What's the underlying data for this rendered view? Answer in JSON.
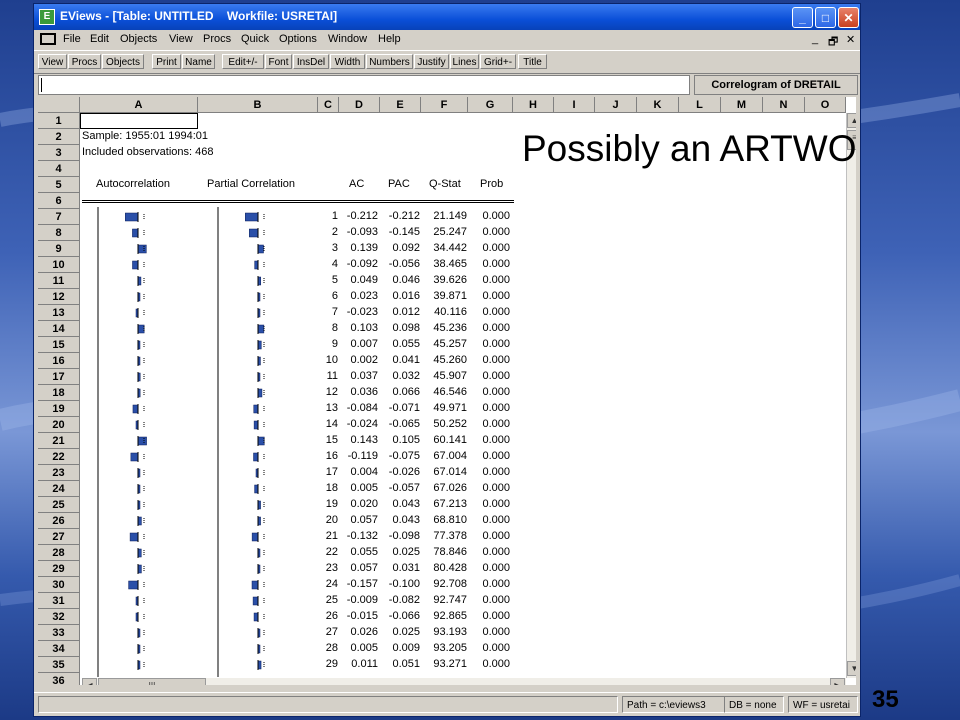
{
  "window": {
    "title": "EViews - [Table: UNTITLED    Workfile: USRETAI]",
    "minimize": "_",
    "maximize": "□",
    "close": "✕"
  },
  "menu": [
    "File",
    "Edit",
    "Objects",
    "View",
    "Procs",
    "Quick",
    "Options",
    "Window",
    "Help"
  ],
  "mdi_controls": [
    "_",
    "🗗",
    "✕"
  ],
  "toolbar": [
    "View",
    "Procs",
    "Objects",
    "Print",
    "Name",
    "Edit+/-",
    "Font",
    "InsDel",
    "Width",
    "Numbers",
    "Justify",
    "Lines",
    "Grid+-",
    "Title"
  ],
  "edit_value": "",
  "object_label": "Correlogram of DRETAIL",
  "columns": [
    "A",
    "B",
    "C",
    "D",
    "E",
    "F",
    "G",
    "H",
    "I",
    "J",
    "K",
    "L",
    "M",
    "N",
    "O"
  ],
  "sheet": {
    "sample": "Sample: 1955:01 1994:01",
    "observations": "Included observations: 468",
    "headers": [
      "Autocorrelation",
      "Partial Correlation",
      "AC",
      "PAC",
      "Q-Stat",
      "Prob"
    ],
    "rows": [
      {
        "lag": "1",
        "ac": "-0.212",
        "pac": "-0.212",
        "q": "21.149",
        "p": "0.000"
      },
      {
        "lag": "2",
        "ac": "-0.093",
        "pac": "-0.145",
        "q": "25.247",
        "p": "0.000"
      },
      {
        "lag": "3",
        "ac": "0.139",
        "pac": "0.092",
        "q": "34.442",
        "p": "0.000"
      },
      {
        "lag": "4",
        "ac": "-0.092",
        "pac": "-0.056",
        "q": "38.465",
        "p": "0.000"
      },
      {
        "lag": "5",
        "ac": "0.049",
        "pac": "0.046",
        "q": "39.626",
        "p": "0.000"
      },
      {
        "lag": "6",
        "ac": "0.023",
        "pac": "0.016",
        "q": "39.871",
        "p": "0.000"
      },
      {
        "lag": "7",
        "ac": "-0.023",
        "pac": "0.012",
        "q": "40.116",
        "p": "0.000"
      },
      {
        "lag": "8",
        "ac": "0.103",
        "pac": "0.098",
        "q": "45.236",
        "p": "0.000"
      },
      {
        "lag": "9",
        "ac": "0.007",
        "pac": "0.055",
        "q": "45.257",
        "p": "0.000"
      },
      {
        "lag": "10",
        "ac": "0.002",
        "pac": "0.041",
        "q": "45.260",
        "p": "0.000"
      },
      {
        "lag": "11",
        "ac": "0.037",
        "pac": "0.032",
        "q": "45.907",
        "p": "0.000"
      },
      {
        "lag": "12",
        "ac": "0.036",
        "pac": "0.066",
        "q": "46.546",
        "p": "0.000"
      },
      {
        "lag": "13",
        "ac": "-0.084",
        "pac": "-0.071",
        "q": "49.971",
        "p": "0.000"
      },
      {
        "lag": "14",
        "ac": "-0.024",
        "pac": "-0.065",
        "q": "50.252",
        "p": "0.000"
      },
      {
        "lag": "15",
        "ac": "0.143",
        "pac": "0.105",
        "q": "60.141",
        "p": "0.000"
      },
      {
        "lag": "16",
        "ac": "-0.119",
        "pac": "-0.075",
        "q": "67.004",
        "p": "0.000"
      },
      {
        "lag": "17",
        "ac": "0.004",
        "pac": "-0.026",
        "q": "67.014",
        "p": "0.000"
      },
      {
        "lag": "18",
        "ac": "0.005",
        "pac": "-0.057",
        "q": "67.026",
        "p": "0.000"
      },
      {
        "lag": "19",
        "ac": "0.020",
        "pac": "0.043",
        "q": "67.213",
        "p": "0.000"
      },
      {
        "lag": "20",
        "ac": "0.057",
        "pac": "0.043",
        "q": "68.810",
        "p": "0.000"
      },
      {
        "lag": "21",
        "ac": "-0.132",
        "pac": "-0.098",
        "q": "77.378",
        "p": "0.000"
      },
      {
        "lag": "22",
        "ac": "0.055",
        "pac": "0.025",
        "q": "78.846",
        "p": "0.000"
      },
      {
        "lag": "23",
        "ac": "0.057",
        "pac": "0.031",
        "q": "80.428",
        "p": "0.000"
      },
      {
        "lag": "24",
        "ac": "-0.157",
        "pac": "-0.100",
        "q": "92.708",
        "p": "0.000"
      },
      {
        "lag": "25",
        "ac": "-0.009",
        "pac": "-0.082",
        "q": "92.747",
        "p": "0.000"
      },
      {
        "lag": "26",
        "ac": "-0.015",
        "pac": "-0.066",
        "q": "92.865",
        "p": "0.000"
      },
      {
        "lag": "27",
        "ac": "0.026",
        "pac": "0.025",
        "q": "93.193",
        "p": "0.000"
      },
      {
        "lag": "28",
        "ac": "0.005",
        "pac": "0.009",
        "q": "93.205",
        "p": "0.000"
      },
      {
        "lag": "29",
        "ac": "0.011",
        "pac": "0.051",
        "q": "93.271",
        "p": "0.000"
      }
    ]
  },
  "status": {
    "path": "Path = c:\\eviews3",
    "db": "DB = none",
    "wf": "WF = usretai"
  },
  "annotation": "Possibly an ARTWO",
  "slide_number": "35"
}
